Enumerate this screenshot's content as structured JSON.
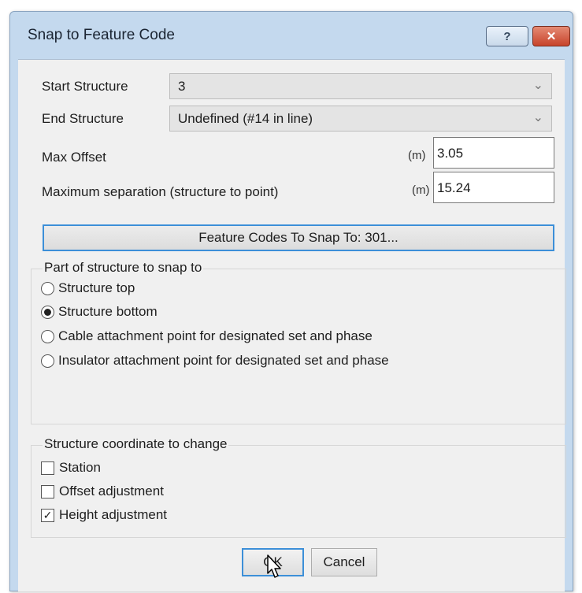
{
  "dialog": {
    "title": "Snap to Feature Code",
    "help_label": "?",
    "close_label": "✕"
  },
  "start_structure": {
    "label": "Start Structure",
    "value": "3"
  },
  "end_structure": {
    "label": "End Structure",
    "value": "Undefined (#14 in line)"
  },
  "max_offset": {
    "label": "Max Offset",
    "unit": "(m)",
    "value": "3.05"
  },
  "max_separation": {
    "label": "Maximum separation (structure to point)",
    "unit": "(m)",
    "value": "15.24"
  },
  "feature_codes_button": "Feature Codes To Snap To: 301...",
  "part_group": {
    "title": "Part of structure to snap to",
    "options": [
      {
        "label": "Structure top",
        "checked": false
      },
      {
        "label": "Structure bottom",
        "checked": true
      },
      {
        "label": "Cable attachment point for designated set and phase",
        "checked": false
      },
      {
        "label": "Insulator attachment point for designated set and phase",
        "checked": false
      }
    ]
  },
  "coord_group": {
    "title": "Structure coordinate to change",
    "options": [
      {
        "label": "Station",
        "checked": false
      },
      {
        "label": "Offset adjustment",
        "checked": false
      },
      {
        "label": "Height adjustment",
        "checked": true
      }
    ]
  },
  "buttons": {
    "ok": "OK",
    "cancel": "Cancel"
  },
  "icons": {
    "dropdown": "chevron-down-icon",
    "check": "checkmark-icon",
    "cursor": "mouse-pointer-icon"
  },
  "colors": {
    "focus": "#3c8fd8",
    "titlebar": "#c4d9ee",
    "close": "#c7432a"
  }
}
